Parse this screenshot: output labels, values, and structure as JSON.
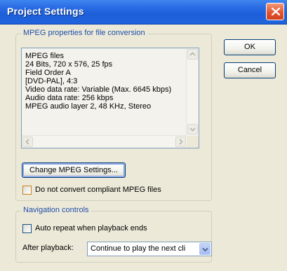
{
  "window": {
    "title": "Project Settings"
  },
  "mpeg_group": {
    "legend": "MPEG properties for file conversion",
    "lines": [
      "MPEG files",
      "24 Bits, 720 x 576, 25 fps",
      "Field Order A",
      "[DVD-PAL], 4:3",
      "Video data rate: Variable (Max.  6645 kbps)",
      "Audio data rate: 256 kbps",
      "MPEG audio layer 2, 48 KHz, Stereo"
    ],
    "change_button": "Change MPEG Settings...",
    "do_not_convert_label": "Do not convert compliant MPEG files",
    "do_not_convert_checked": false
  },
  "buttons": {
    "ok": "OK",
    "cancel": "Cancel"
  },
  "navigation_group": {
    "legend": "Navigation controls",
    "auto_repeat_label": "Auto repeat when playback ends",
    "auto_repeat_checked": false,
    "after_playback_label": "After playback:",
    "after_playback_value": "Continue to play the next cli"
  },
  "colors": {
    "titlebar": "#2a6ce4",
    "close_button": "#e0502a",
    "group_legend": "#1f4ea8",
    "dialog_bg": "#ece9d8"
  }
}
